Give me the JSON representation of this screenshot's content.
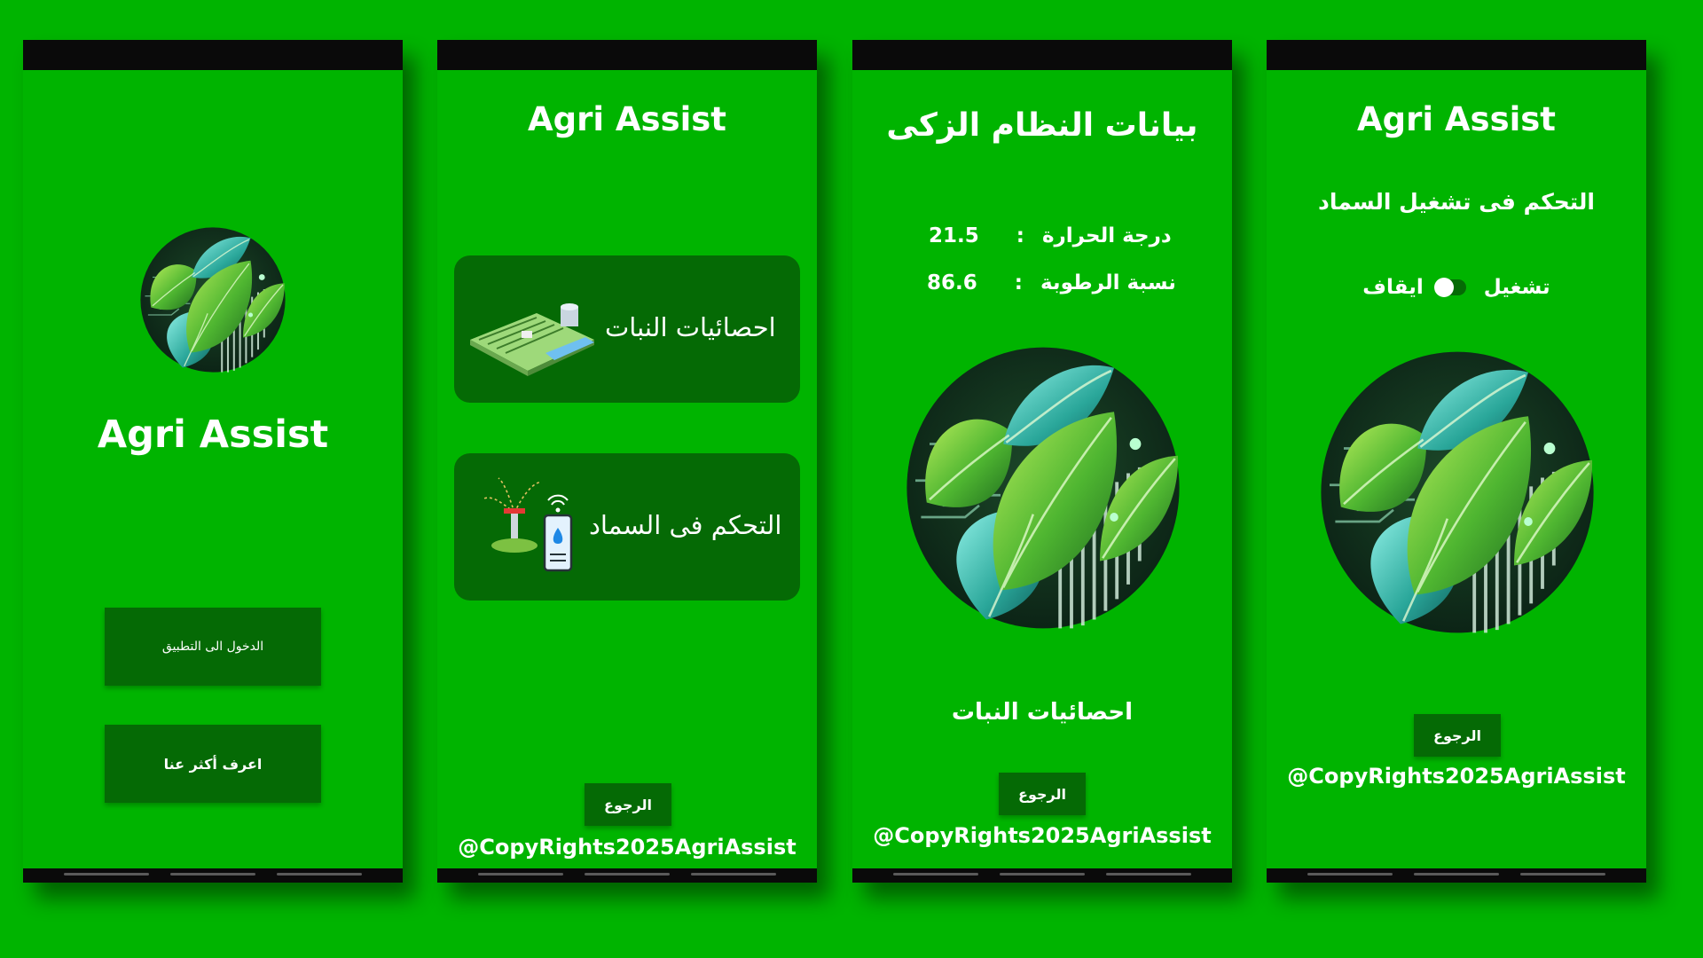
{
  "screen1": {
    "app_title": "Agri Assist",
    "enter_button": "الدخول الى التطبيق",
    "about_button": "اعرف أكثر عنا",
    "logo_icon": "leaf-circuit-logo"
  },
  "screen2": {
    "app_title": "Agri Assist",
    "card_stats_label": "احصائيات النبات",
    "card_stats_icon": "smart-farm-icon",
    "card_fert_label": "التحكم فى السماد",
    "card_fert_icon": "sprinkler-phone-icon",
    "back_button": "الرجوع",
    "copyright": "@CopyRights2025AgriAssist"
  },
  "screen3": {
    "title": "بيانات النظام الزكى",
    "temp_label": "درجة الحرارة",
    "temp_sep": ":",
    "temp_value": "21.5",
    "humidity_label": "نسبة الرطوبة",
    "humidity_sep": ":",
    "humidity_value": "86.6",
    "section_label": "احصائيات النبات",
    "back_button": "الرجوع",
    "copyright": "@CopyRights2025AgriAssist"
  },
  "screen4": {
    "app_title": "Agri Assist",
    "subtitle": "التحكم فى تشغيل السماد",
    "on_label": "تشغيل",
    "off_label": "ايقاف",
    "toggle_state": "off",
    "back_button": "الرجوع",
    "copyright": "@CopyRights2025AgriAssist"
  },
  "colors": {
    "background": "#00b400",
    "button_dark": "#056a05",
    "bars": "#0a0a0a"
  }
}
